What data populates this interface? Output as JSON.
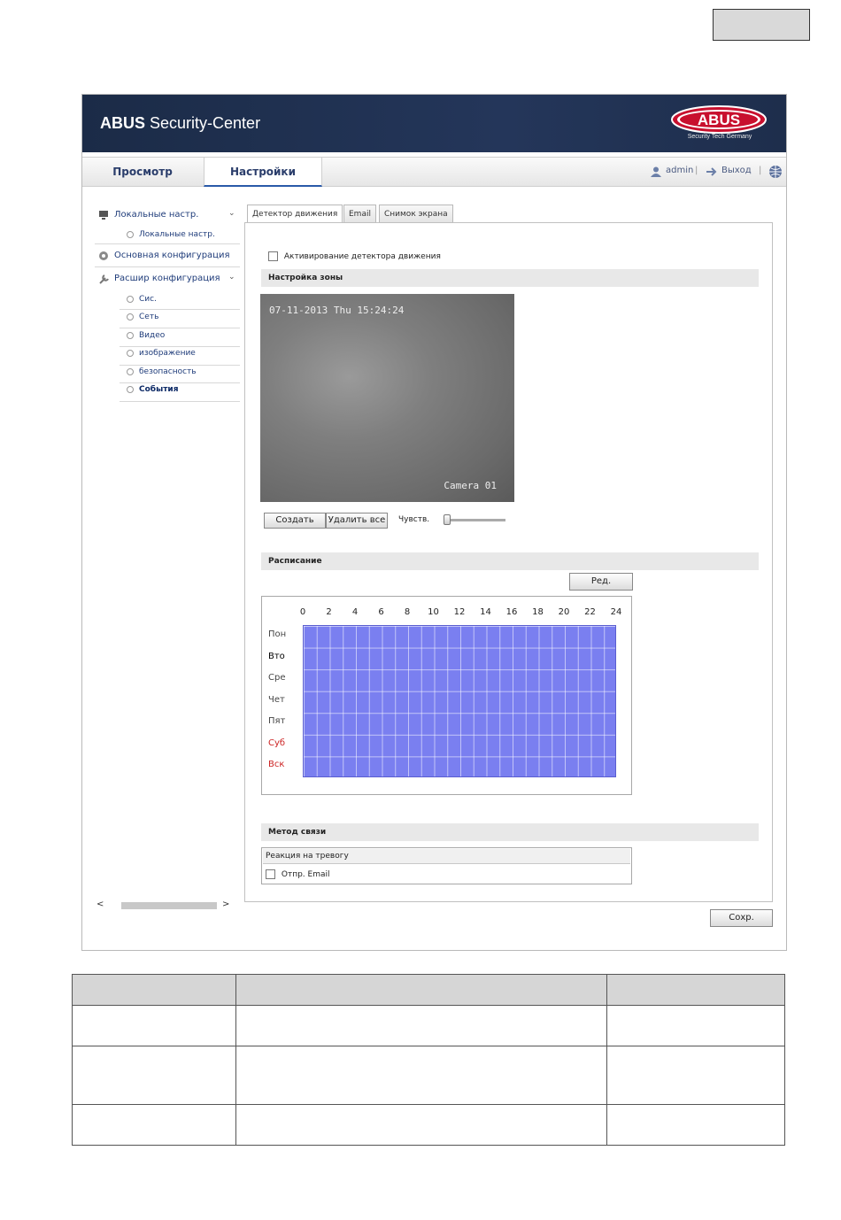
{
  "app": {
    "title_bold": "ABUS",
    "title_rest": " Security-Center",
    "logo_text": "ABUS",
    "logo_subtitle": "Security Tech Germany",
    "colors": {
      "banner": "#1b2b47",
      "accent": "#2a5aa8",
      "logo_red": "#c8102e",
      "schedule_fill": "#7a7ff0"
    }
  },
  "nav": {
    "tabs": [
      {
        "label": "Просмотр"
      },
      {
        "label": "Настройки"
      }
    ],
    "user": "admin",
    "logout": "Выход",
    "separator": "|",
    "icons": {
      "user": "user-icon",
      "logout": "logout-icon",
      "help": "globe-help-icon"
    }
  },
  "sidebar": {
    "local_header": "Локальные настр.",
    "local_sub": "Локальные настр.",
    "basic_header": "Основная конфигурация",
    "adv_header": "Расшир конфигурация",
    "adv_items": [
      "Сис.",
      "Сеть",
      "Видео",
      "изображение",
      "безопасность",
      "События"
    ],
    "active_item": "События"
  },
  "content": {
    "tabs": [
      "Детектор движения",
      "Email",
      "Снимок экрана"
    ],
    "enable_label": "Активирование детектора движения",
    "zone_header": "Настройка зоны",
    "camera_timestamp": "07-11-2013 Thu 15:24:24",
    "camera_name": "Camera 01",
    "btn_create": "Создать",
    "btn_delete_all": "Удалить все",
    "sensitivity_label": "Чувств.",
    "sensitivity_level": 0,
    "schedule_header": "Расписание",
    "btn_edit": "Ред.",
    "hours": [
      "0",
      "2",
      "4",
      "6",
      "8",
      "10",
      "12",
      "14",
      "16",
      "18",
      "20",
      "22",
      "24"
    ],
    "days": [
      "Пон",
      "Вто",
      "Сре",
      "Чет",
      "Пят",
      "Суб",
      "Вск"
    ],
    "schedule_all_selected": true,
    "link_header": "Метод связи",
    "alarm_table_header": "Реакция на тревогу",
    "send_email_label": "Отпр. Email",
    "btn_save": "Сохр."
  }
}
